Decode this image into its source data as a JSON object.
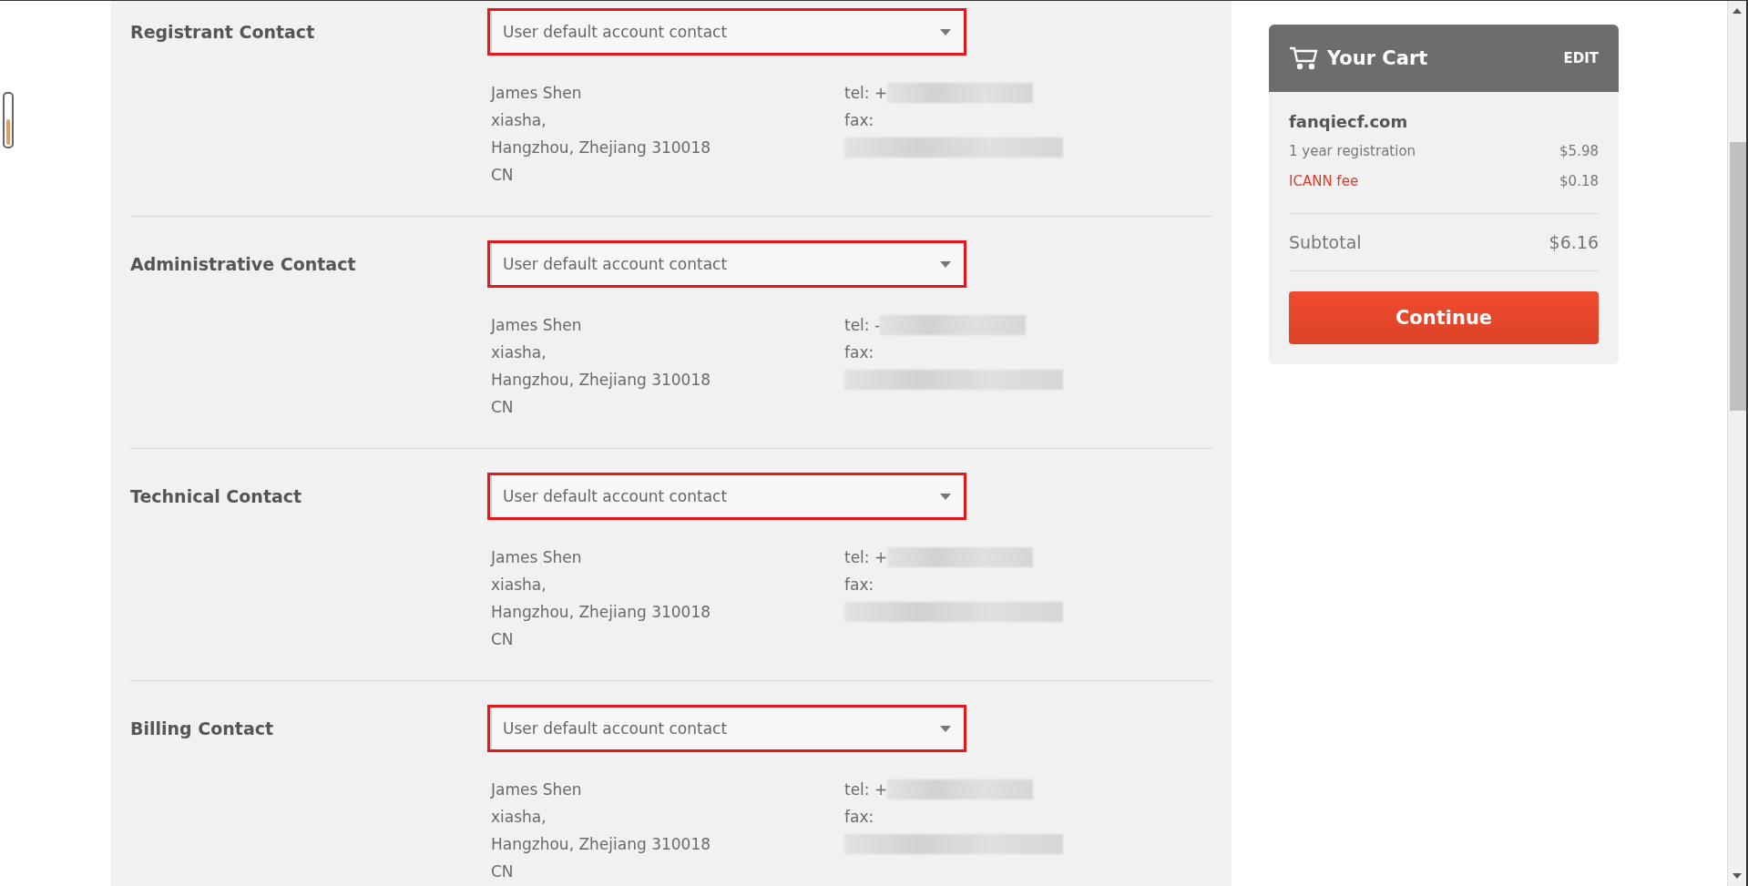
{
  "contacts": [
    {
      "label": "Registrant Contact",
      "select": {
        "value": "User default account contact"
      },
      "highlighted": true,
      "address": [
        "James Shen",
        "xiasha,",
        "Hangzhou, Zhejiang 310018",
        "CN"
      ],
      "tel": "tel: +",
      "fax": "fax:"
    },
    {
      "label": "Administrative Contact",
      "select": {
        "value": "User default account contact"
      },
      "highlighted": true,
      "address": [
        "James Shen",
        "xiasha,",
        "Hangzhou, Zhejiang 310018",
        "CN"
      ],
      "tel": "tel: -",
      "fax": "fax:"
    },
    {
      "label": "Technical Contact",
      "select": {
        "value": "User default account contact"
      },
      "highlighted": true,
      "address": [
        "James Shen",
        "xiasha,",
        "Hangzhou, Zhejiang 310018",
        "CN"
      ],
      "tel": "tel: +",
      "fax": "fax:"
    },
    {
      "label": "Billing Contact",
      "select": {
        "value": "User default account contact"
      },
      "highlighted": true,
      "address": [
        "James Shen",
        "xiasha,",
        "Hangzhou, Zhejiang 310018",
        "CN"
      ],
      "tel": "tel: +",
      "fax": "fax:"
    }
  ],
  "cart": {
    "title": "Your Cart",
    "edit": "EDIT",
    "domain": "fanqiecf.com",
    "lines": [
      {
        "kind": "plain",
        "label": "1 year registration",
        "price": "$5.98"
      },
      {
        "kind": "fee",
        "label": "ICANN fee",
        "price": "$0.18"
      }
    ],
    "subtotal_label": "Subtotal",
    "subtotal": "$6.16",
    "button": "Continue"
  }
}
